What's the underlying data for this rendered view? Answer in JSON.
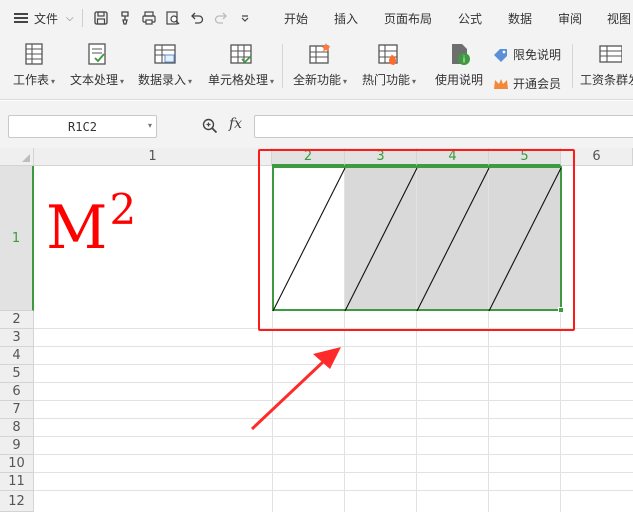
{
  "menubar": {
    "file_label": "文件",
    "tabs": [
      "开始",
      "插入",
      "页面布局",
      "公式",
      "数据",
      "审阅",
      "视图"
    ]
  },
  "ribbon": {
    "buttons": [
      {
        "label": "工作表",
        "icon": "worksheet-icon"
      },
      {
        "label": "文本处理",
        "icon": "text-process-icon"
      },
      {
        "label": "数据录入",
        "icon": "data-entry-icon"
      },
      {
        "label": "单元格处理",
        "icon": "cell-process-icon"
      },
      {
        "label": "全新功能",
        "icon": "new-feature-icon"
      },
      {
        "label": "热门功能",
        "icon": "hot-feature-icon"
      },
      {
        "label": "使用说明",
        "icon": "usage-guide-icon"
      }
    ],
    "limited_free_label": "限免说明",
    "membership_label": "开通会员",
    "payroll_label": "工资条群发"
  },
  "formula_bar": {
    "name_box": "R1C2",
    "fx_label": "fx",
    "formula": ""
  },
  "sheet": {
    "columns": [
      "1",
      "2",
      "3",
      "4",
      "5",
      "6"
    ],
    "selected_columns": [
      "2",
      "3",
      "4",
      "5"
    ],
    "rows": [
      "1",
      "2",
      "3",
      "4",
      "5",
      "6",
      "7",
      "8",
      "9",
      "10",
      "11",
      "12"
    ],
    "selected_row": "1",
    "cell_text": {
      "base": "M",
      "exponent": "2"
    }
  },
  "colors": {
    "accent_green": "#3e9a3e",
    "annotation_red": "#ff1a1a",
    "cell_text_red": "#ff0000",
    "cell_fill_gray": "#d9d9d9"
  }
}
